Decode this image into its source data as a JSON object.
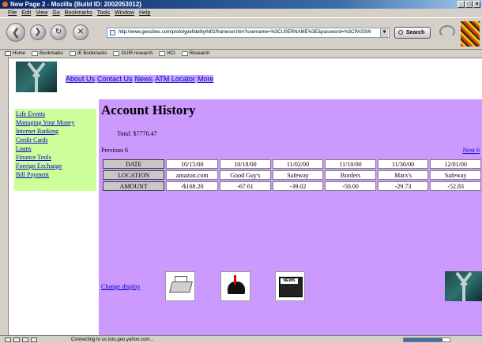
{
  "window": {
    "title": "New Page 2 - Mozilla {Build ID: 2002053012}",
    "buttons": [
      "_",
      "□",
      "×"
    ]
  },
  "menu": [
    "File",
    "Edit",
    "View",
    "Go",
    "Bookmarks",
    "Tools",
    "Window",
    "Help"
  ],
  "toolbar": {
    "url": "http://www.geocities.com/prototypefidelity/hifi2/frameset.htm?username=%3CUSERNAME%3E&password=%3CPASSW",
    "search_label": "Search"
  },
  "bookmarks": [
    "Home",
    "Bookmarks",
    "IE Bookmarks",
    "GUIR research",
    "HCI",
    "Research"
  ],
  "top_nav": [
    "About Us",
    "Contact Us",
    "News",
    "ATM Locator",
    "More"
  ],
  "sidebar": [
    "Life Events",
    "Managing Your Money",
    "Internet Banking",
    "Credit Cards",
    "Loans",
    "Finance Tools",
    "Foreign Exchange",
    "Bill Payment"
  ],
  "account": {
    "title": "Account History",
    "total": "Total: $7770.47",
    "prev": "Previous 6",
    "next": "Next 6",
    "row_labels": [
      "DATE",
      "LOCATION",
      "AMOUNT"
    ],
    "dates": [
      "10/15/00",
      "10/18/00",
      "11/02/00",
      "11/10/00",
      "11/30/00",
      "12/01/00"
    ],
    "locations": [
      "amazon.com",
      "Good Guy's",
      "Safeway",
      "Borders",
      "Marx's",
      "Safeway"
    ],
    "amounts": [
      "-$168.20",
      "-67.61",
      "-39.02",
      "-50.00",
      "-29.73",
      "-52.83"
    ],
    "change_display": "Change display",
    "news_label": "NEWS"
  },
  "status": {
    "text": "Connecting to us.toto.geo.yahoo.com...",
    "progress": 0.85
  },
  "colors": {
    "sidebar_bg": "#ccff99",
    "main_bg": "#cc99ff",
    "link": "#0000cc"
  }
}
